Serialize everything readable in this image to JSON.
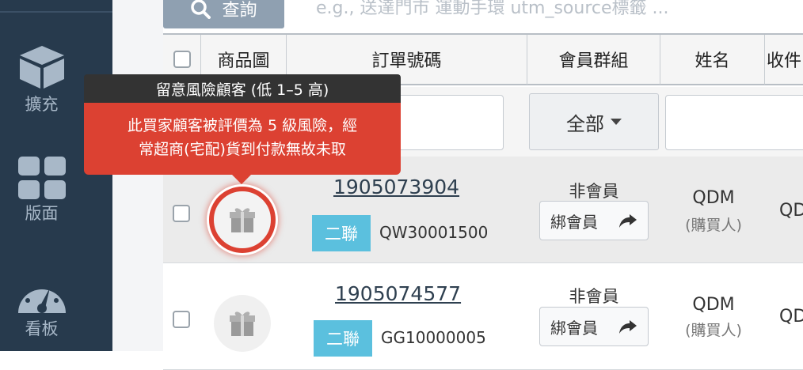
{
  "sidebar": {
    "items": [
      {
        "icon": "cube-icon",
        "label": "擴充"
      },
      {
        "icon": "grid-icon",
        "label": "版面"
      },
      {
        "icon": "dashboard-icon",
        "label": "看板"
      }
    ]
  },
  "toolbar": {
    "query_label": "查詢",
    "search_placeholder": "e.g.,  送達門市    運動手環    utm_source標籤  ..."
  },
  "table": {
    "headers": [
      "商品圖",
      "訂單號碼",
      "會員群組",
      "姓名",
      "收件"
    ],
    "filter_all_label": "全部",
    "rows": [
      {
        "order_no": "1905073904",
        "badge": "二聯",
        "sub_no": "QW30001500",
        "member": "非會員",
        "bind_label": "綁會員",
        "name": "QDM",
        "role": "(購買人)",
        "recipient": "QD"
      },
      {
        "order_no": "1905074577",
        "badge": "二聯",
        "sub_no": "GG10000005",
        "member": "非會員",
        "bind_label": "綁會員",
        "name": "QDM",
        "role": "(購買人)",
        "recipient": "QD"
      }
    ]
  },
  "tooltip": {
    "title": "留意風險顧客 (低 1–5 高)",
    "line1": "此買家顧客被評價為 5 級風險，經",
    "line2": "常超商(宅配)貨到付款無故未取"
  },
  "colors": {
    "sidebar": "#273a4d",
    "risk": "#dc4132",
    "badge": "#5bc0de",
    "query": "#8fa0b1"
  }
}
